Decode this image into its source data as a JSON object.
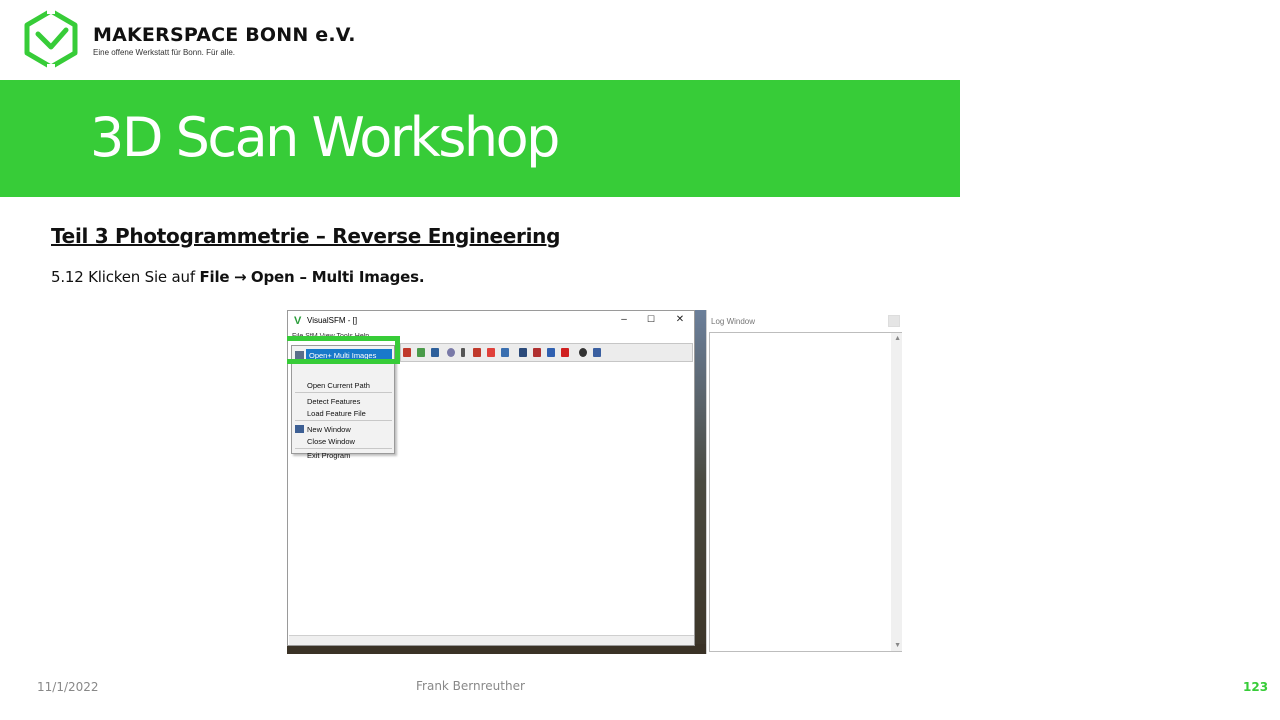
{
  "brand": {
    "title": "MAKERSPACE BONN e.V.",
    "tagline": "Eine offene Werkstatt für Bonn. Für alle.",
    "logo_icon": "hexagon-check-logo",
    "accent": "#37cc38"
  },
  "banner": {
    "title": "3D Scan Workshop"
  },
  "content": {
    "subtitle": "Teil 3  Photogrammetrie  – Reverse Engineering",
    "step_prefix": "5.12 Klicken Sie auf ",
    "step_file": "File",
    "step_arrow": "→",
    "step_target": "Open – Multi Images."
  },
  "app_window": {
    "title": "VisualSFM - []",
    "menubar": "File  SfM  View  Tools  Help",
    "controls": [
      "–",
      "☐",
      "✕"
    ],
    "file_menu": {
      "items": [
        "Open+ Multi Images",
        "Open Current Path",
        "Detect Features",
        "Load Feature File",
        "New Window",
        "Close Window",
        "Exit Program"
      ]
    }
  },
  "log_window": {
    "title": "Log Window"
  },
  "footer": {
    "date": "11/1/2022",
    "author": "Frank Bernreuther",
    "page": "123"
  }
}
